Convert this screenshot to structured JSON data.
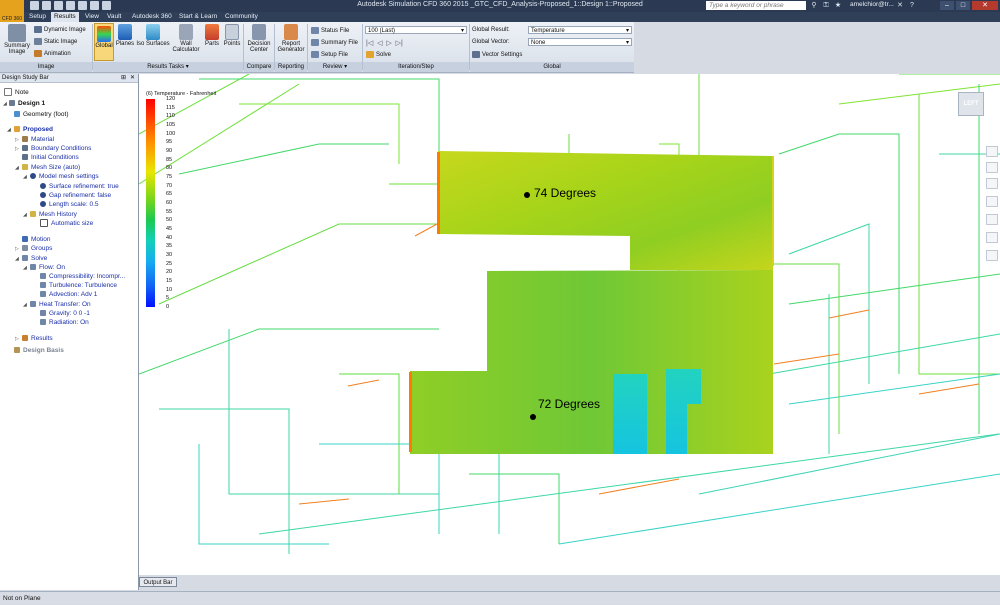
{
  "app": {
    "title": "Autodesk Simulation CFD 360 2015 _GTC_CFD_Analysis-Proposed_1::Design 1::Proposed",
    "search_placeholder": "Type a keyword or phrase",
    "user": "amelchior@tr...",
    "app_button": "CFD 360"
  },
  "menu_tabs": [
    "Setup",
    "Results",
    "View",
    "Vault",
    "Autodesk 360",
    "Start & Learn",
    "Community"
  ],
  "active_tab": "Results",
  "ribbon": {
    "image_group": {
      "summary_image": "Summary Image",
      "dynamic_image": "Dynamic Image",
      "static_image": "Static Image",
      "animation": "Animation",
      "label": "Image"
    },
    "results_tasks": {
      "global": "Global",
      "planes": "Planes",
      "iso_surfaces": "Iso Surfaces",
      "wall_calculator": "Wall Calculator",
      "parts": "Parts",
      "points": "Points",
      "label": "Results Tasks"
    },
    "compare": {
      "decision_center": "Decision Center",
      "label": "Compare"
    },
    "reporting": {
      "report_generator": "Report Generator",
      "label": "Reporting"
    },
    "review": {
      "status_file": "Status File",
      "summary_file": "Summary File",
      "setup_file": "Setup File",
      "label": "Review"
    },
    "iteration": {
      "current": "100 (Last)",
      "solve": "Solve",
      "label": "Iteration/Step"
    },
    "global": {
      "global_result_label": "Global Result:",
      "global_result_value": "Temperature",
      "global_vector_label": "Global Vector:",
      "global_vector_value": "None",
      "vector_settings": "Vector Settings",
      "label": "Global"
    }
  },
  "panel": {
    "title": "Design Study Bar",
    "items": [
      "Note",
      "Design 1",
      "Geometry (foot)",
      "Proposed",
      "Material",
      "Boundary Conditions",
      "Initial Conditions",
      "Mesh Size (auto)",
      "Model mesh settings",
      "Surface refinement: true",
      "Gap refinement: false",
      "Length scale: 0.5",
      "Mesh History",
      "Automatic size",
      "Motion",
      "Groups",
      "Solve",
      "Flow: On",
      "Compressibility: Incompr...",
      "Turbulence: Turbulence",
      "Advection: Adv 1",
      "Heat Transfer: On",
      "Gravity: 0 0 -1",
      "Radiation: On",
      "Results",
      "Design Basis"
    ]
  },
  "legend": {
    "title": "(6) Temperature - Fahrenheit",
    "ticks": [
      "120",
      "115",
      "110",
      "105",
      "100",
      "95",
      "90",
      "85",
      "80",
      "75",
      "70",
      "65",
      "60",
      "55",
      "50",
      "45",
      "40",
      "35",
      "30",
      "25",
      "20",
      "15",
      "10",
      "5",
      "0"
    ],
    "colors": [
      "#ff0000",
      "#ff8c00",
      "#e9e600",
      "#7ad61a",
      "#1ec84f",
      "#12d1b6",
      "#15aef0",
      "#1262f5",
      "#0010ff"
    ]
  },
  "annotations": [
    "74 Degrees",
    "72 Degrees"
  ],
  "nav_cube_label": "LEFT",
  "output_bar": "Output Bar",
  "status": "Not on Plane"
}
